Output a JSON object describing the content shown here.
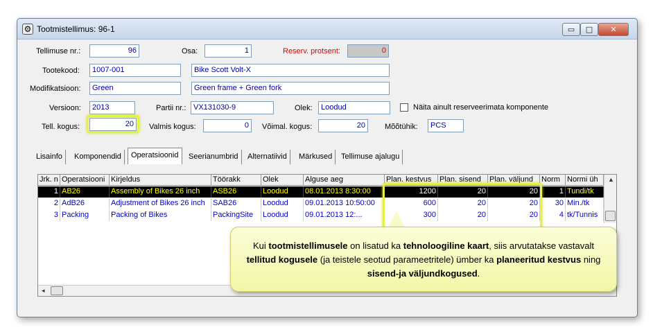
{
  "window": {
    "title": "Tootmistellimus: 96-1",
    "min_glyph": "▭",
    "max_glyph": "□",
    "close_glyph": "✕"
  },
  "form": {
    "tellimuse_nr_label": "Tellimuse nr.:",
    "tellimuse_nr": "96",
    "osa_label": "Osa:",
    "osa": "1",
    "reserv_label": "Reserv. protsent:",
    "reserv": "0",
    "tootekood_label": "Tootekood:",
    "tootekood": "1007-001",
    "tootekood_desc": "Bike Scott Volt-X",
    "modifikatsioon_label": "Modifikatsioon:",
    "modifikatsioon": "Green",
    "modifikatsioon_desc": "Green frame + Green fork",
    "versioon_label": "Versioon:",
    "versioon": "2013",
    "partii_label": "Partii nr.:",
    "partii": "VX131030-9",
    "olek_label": "Olek:",
    "olek": "Loodud",
    "checkbox_label": "Näita ainult reserveerimata komponente",
    "tell_kogus_label": "Tell. kogus:",
    "tell_kogus": "20",
    "valmis_label": "Valmis kogus:",
    "valmis": "0",
    "voimal_label": "Võimal. kogus:",
    "voimal": "20",
    "mootuhik_label": "Mõõtühik:",
    "mootuhik": "PCS"
  },
  "tabs": [
    "Lisainfo",
    "Komponendid",
    "Operatsioonid",
    "Seerianumbrid",
    "Alternatiivid",
    "Märkused",
    "Tellimuse ajalugu"
  ],
  "active_tab": "Operatsioonid",
  "grid": {
    "headers": [
      "Jrk. n",
      "Operatsiooni",
      "Kirjeldus",
      "Töörakk",
      "Olek",
      "Alguse aeg",
      "Plan. kestvus",
      "Plan. sisend",
      "Plan. väljund",
      "Norm",
      "Normi üh"
    ],
    "rows": [
      [
        "1",
        "AB26",
        "Assembly of Bikes 26 inch",
        "ASB26",
        "Loodud",
        "08.01.2013 8:30:00",
        "1200",
        "20",
        "20",
        "1",
        "Tundi/tk"
      ],
      [
        "2",
        "AdB26",
        "Adjustment of Bikes 26 inch",
        "SAB26",
        "Loodud",
        "09.01.2013 10:50:00",
        "600",
        "20",
        "20",
        "30",
        "Min./tk"
      ],
      [
        "3",
        "Packing",
        "Packing of Bikes",
        "PackingSite",
        "Loodud",
        "09.01.2013 12:...",
        "300",
        "20",
        "20",
        "4",
        "tk/Tunnis"
      ]
    ],
    "selected_row": 1
  },
  "callout": {
    "p1": "Kui ",
    "b1": "tootmistellimusele",
    "p2": " on lisatud ka ",
    "b2": "tehnoloogiline kaart",
    "p3": ", siis arvutatakse vastavalt ",
    "b3": "tellitud kogusele",
    "p4": " (ja teistele seotud parameetritele) ümber ka ",
    "b4": "planeeritud kestvus",
    "p5": " ning ",
    "b5": "sisend-ja väljundkogused",
    "p6": "."
  },
  "colors": {
    "highlight": "#e6f046",
    "value_text": "#0000aa",
    "selected_row_bg": "#000000",
    "selected_row_text": "#ffff00"
  }
}
